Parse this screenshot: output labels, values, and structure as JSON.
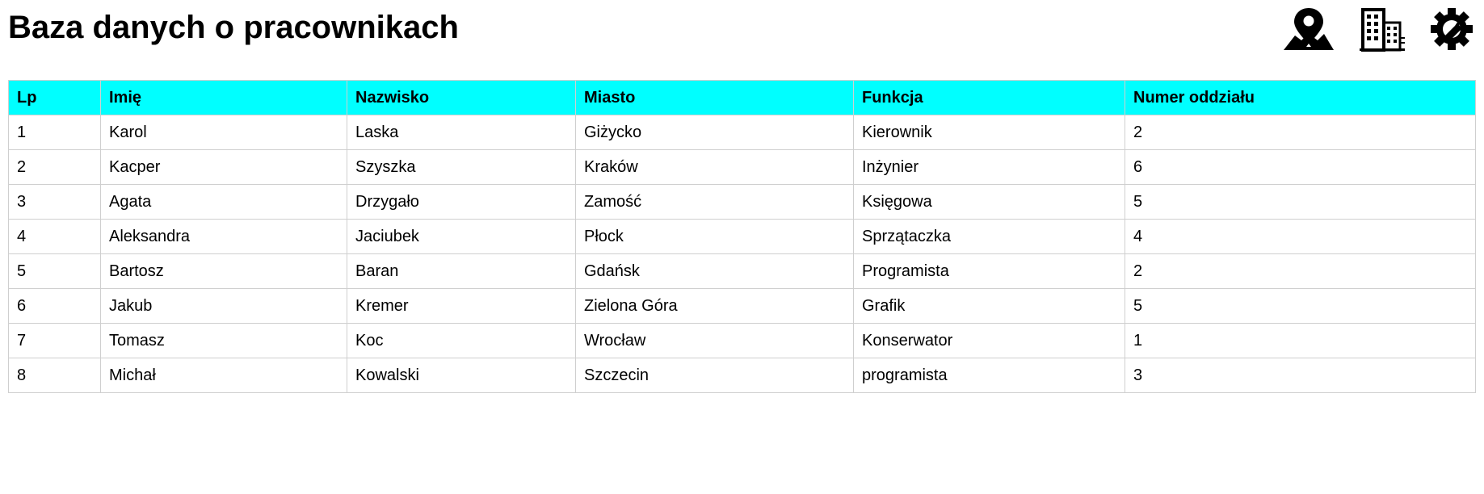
{
  "page": {
    "title": "Baza danych o pracownikach"
  },
  "toolbar": {
    "icons": [
      "map-location-icon",
      "buildings-icon",
      "settings-icon"
    ]
  },
  "colors": {
    "header_bg": "#00ffff",
    "border": "#cfcfcf"
  },
  "table": {
    "headers": [
      "Lp",
      "Imię",
      "Nazwisko",
      "Miasto",
      "Funkcja",
      "Numer oddziału"
    ],
    "rows": [
      [
        "1",
        "Karol",
        "Laska",
        "Giżycko",
        "Kierownik",
        "2"
      ],
      [
        "2",
        "Kacper",
        "Szyszka",
        "Kraków",
        "Inżynier",
        "6"
      ],
      [
        "3",
        "Agata",
        "Drzygało",
        "Zamość",
        "Księgowa",
        "5"
      ],
      [
        "4",
        "Aleksandra",
        "Jaciubek",
        "Płock",
        "Sprzątaczka",
        "4"
      ],
      [
        "5",
        "Bartosz",
        "Baran",
        "Gdańsk",
        "Programista",
        "2"
      ],
      [
        "6",
        "Jakub",
        "Kremer",
        "Zielona Góra",
        "Grafik",
        "5"
      ],
      [
        "7",
        "Tomasz",
        "Koc",
        "Wrocław",
        "Konserwator",
        "1"
      ],
      [
        "8",
        "Michał",
        "Kowalski",
        "Szczecin",
        "programista",
        "3"
      ]
    ]
  }
}
